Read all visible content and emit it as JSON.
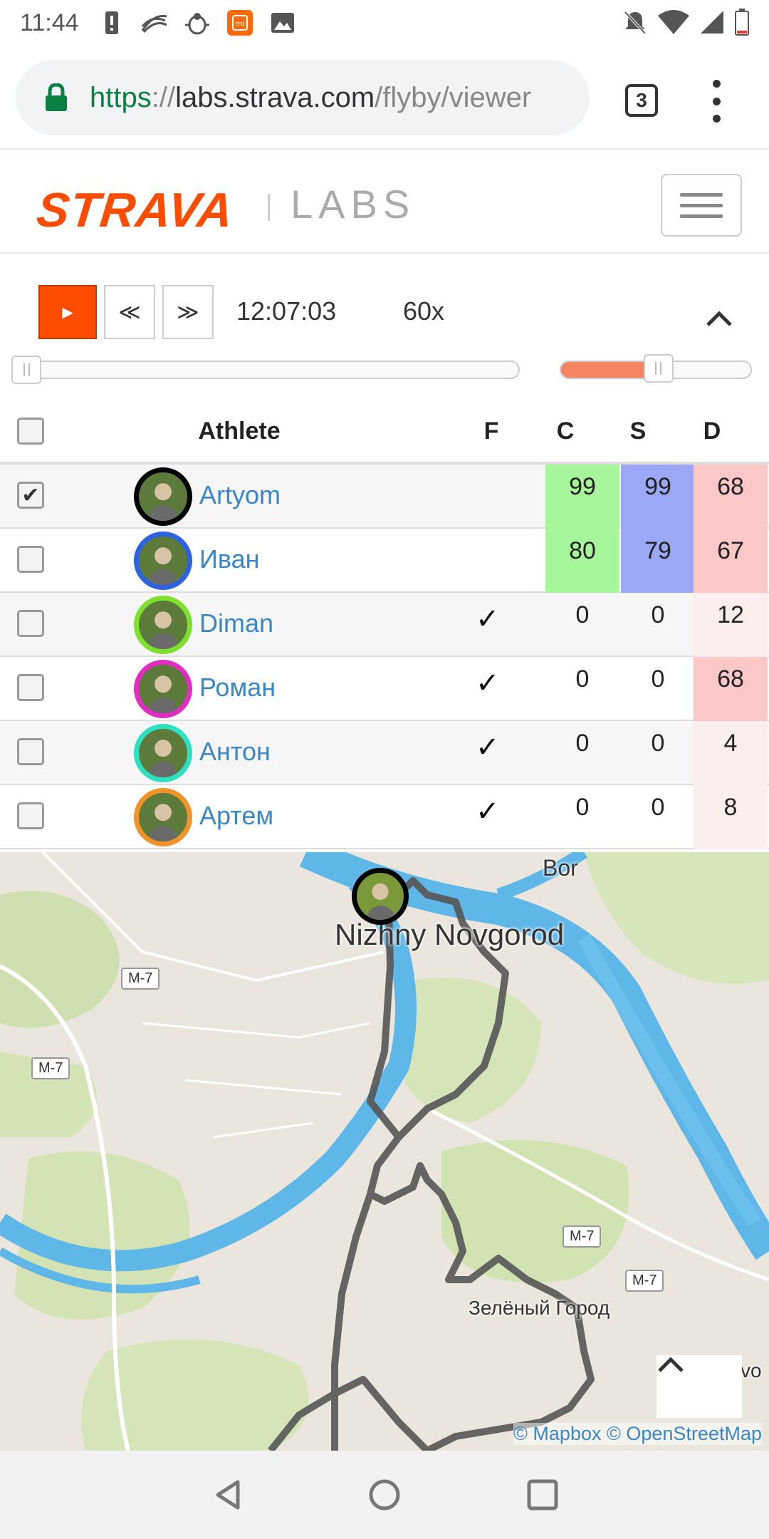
{
  "status_bar": {
    "time": "11:44",
    "left_icons": [
      "alert-icon",
      "swirl-icon",
      "bug-icon",
      "mi-icon",
      "image-icon"
    ],
    "right_icons": [
      "mute-icon",
      "wifi-icon",
      "signal-icon",
      "battery-icon"
    ]
  },
  "browser": {
    "url_scheme": "https",
    "url_sep": "://",
    "url_host": "labs.strava.com",
    "url_path": "/flyby/viewer",
    "tab_count": "3"
  },
  "header": {
    "logo": "STRAVA",
    "section": "LABS"
  },
  "controls": {
    "play_label": "►",
    "rewind_label": "≪",
    "forward_label": "≫",
    "time": "12:07:03",
    "speed": "60x",
    "timeline_progress": 0.0,
    "speed_level": 0.48
  },
  "table": {
    "columns": {
      "athlete": "Athlete",
      "f": "F",
      "c": "C",
      "s": "S",
      "d": "D"
    },
    "rows": [
      {
        "name": "Artyom",
        "checked": "✔",
        "f": "",
        "c": "99",
        "s": "99",
        "d": "68",
        "ring": "#000000"
      },
      {
        "name": "Иван",
        "checked": "",
        "f": "",
        "c": "80",
        "s": "79",
        "d": "67",
        "ring": "#2f62e0"
      },
      {
        "name": "Diman",
        "checked": "",
        "f": "✓",
        "c": "0",
        "s": "0",
        "d": "12",
        "ring": "#7ee02f"
      },
      {
        "name": "Роман",
        "checked": "",
        "f": "✓",
        "c": "0",
        "s": "0",
        "d": "68",
        "ring": "#e02fc0"
      },
      {
        "name": "Антон",
        "checked": "",
        "f": "✓",
        "c": "0",
        "s": "0",
        "d": "4",
        "ring": "#2fe0c0"
      },
      {
        "name": "Артем",
        "checked": "",
        "f": "✓",
        "c": "0",
        "s": "0",
        "d": "8",
        "ring": "#f0932b"
      }
    ]
  },
  "map": {
    "labels": {
      "bor": "Bor",
      "city": "Nizhny Novgorod",
      "zeleny": "Зелёный Город",
      "edge": "vo"
    },
    "shields": [
      "M-7",
      "M-7",
      "M-7",
      "M-7"
    ],
    "attribution": "© Mapbox © OpenStreetMap"
  },
  "colors": {
    "accent": "#fc4c02",
    "link": "#3a87c8",
    "c_high": "#a6f59a",
    "s_high": "#9aa8f5",
    "d_high": "#fbc7c7",
    "d_low": "#fdeeee",
    "river": "#5fb7e8"
  }
}
